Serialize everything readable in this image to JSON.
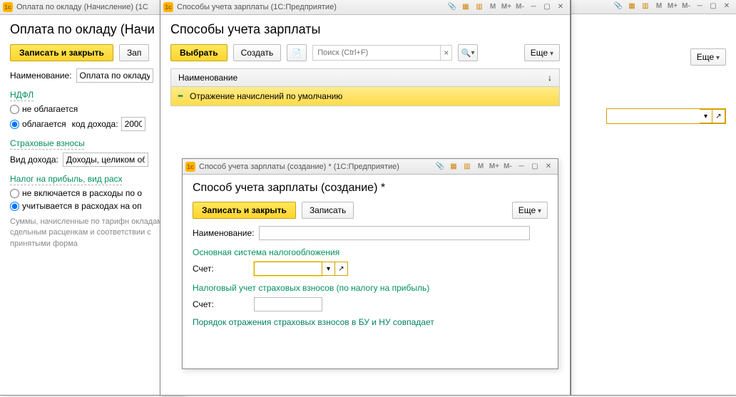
{
  "win1": {
    "title": "Оплата по окладу (Начисление) (1С",
    "heading": "Оплата по окладу (Начи",
    "btn_save_close": "Записать и закрыть",
    "btn_save": "Зап",
    "label_name": "Наименование:",
    "value_name": "Оплата по окладу",
    "section_ndfl": "НДФЛ",
    "radio_not_taxed": "не облагается",
    "radio_taxed": "облагается",
    "label_income_code": "код дохода:",
    "value_income_code": "2000",
    "section_insurance": "Страховые взносы",
    "label_income_type": "Вид дохода:",
    "value_income_type": "Доходы, целиком об",
    "section_profit_tax": "Налог на прибыль, вид расх",
    "radio_not_included": "не включается в расходы по о",
    "radio_included": "учитывается в расходах на оп",
    "info": "Суммы, начисленные по тарифн окладам, сдельным расценкам и соответствии с принятыми форма"
  },
  "win2": {
    "title": "Способы учета зарплаты  (1С:Предприятие)",
    "heading": "Способы учета зарплаты",
    "btn_select": "Выбрать",
    "btn_create": "Создать",
    "search_placeholder": "Поиск (Ctrl+F)",
    "btn_more": "Еще",
    "col_name": "Наименование",
    "row1": "Отражение начислений по умолчанию"
  },
  "win3": {
    "title": "Способ учета зарплаты (создание) *  (1С:Предприятие)",
    "heading": "Способ учета зарплаты (создание) *",
    "btn_save_close": "Записать и закрыть",
    "btn_save": "Записать",
    "btn_more": "Еще",
    "label_name": "Наименование:",
    "section_main_tax": "Основная система налогообложения",
    "label_account": "Счет:",
    "section_tax_accounting": "Налоговый учет страховых взносов (по налогу на прибыль)",
    "label_account2": "Счет:",
    "note": "Порядок отражения страховых взносов в БУ и НУ совпадает"
  },
  "bg_win": {
    "btn_more": "Еще"
  },
  "titlebar_btns": {
    "m": "M",
    "mplus": "M+",
    "mminus": "M-"
  }
}
